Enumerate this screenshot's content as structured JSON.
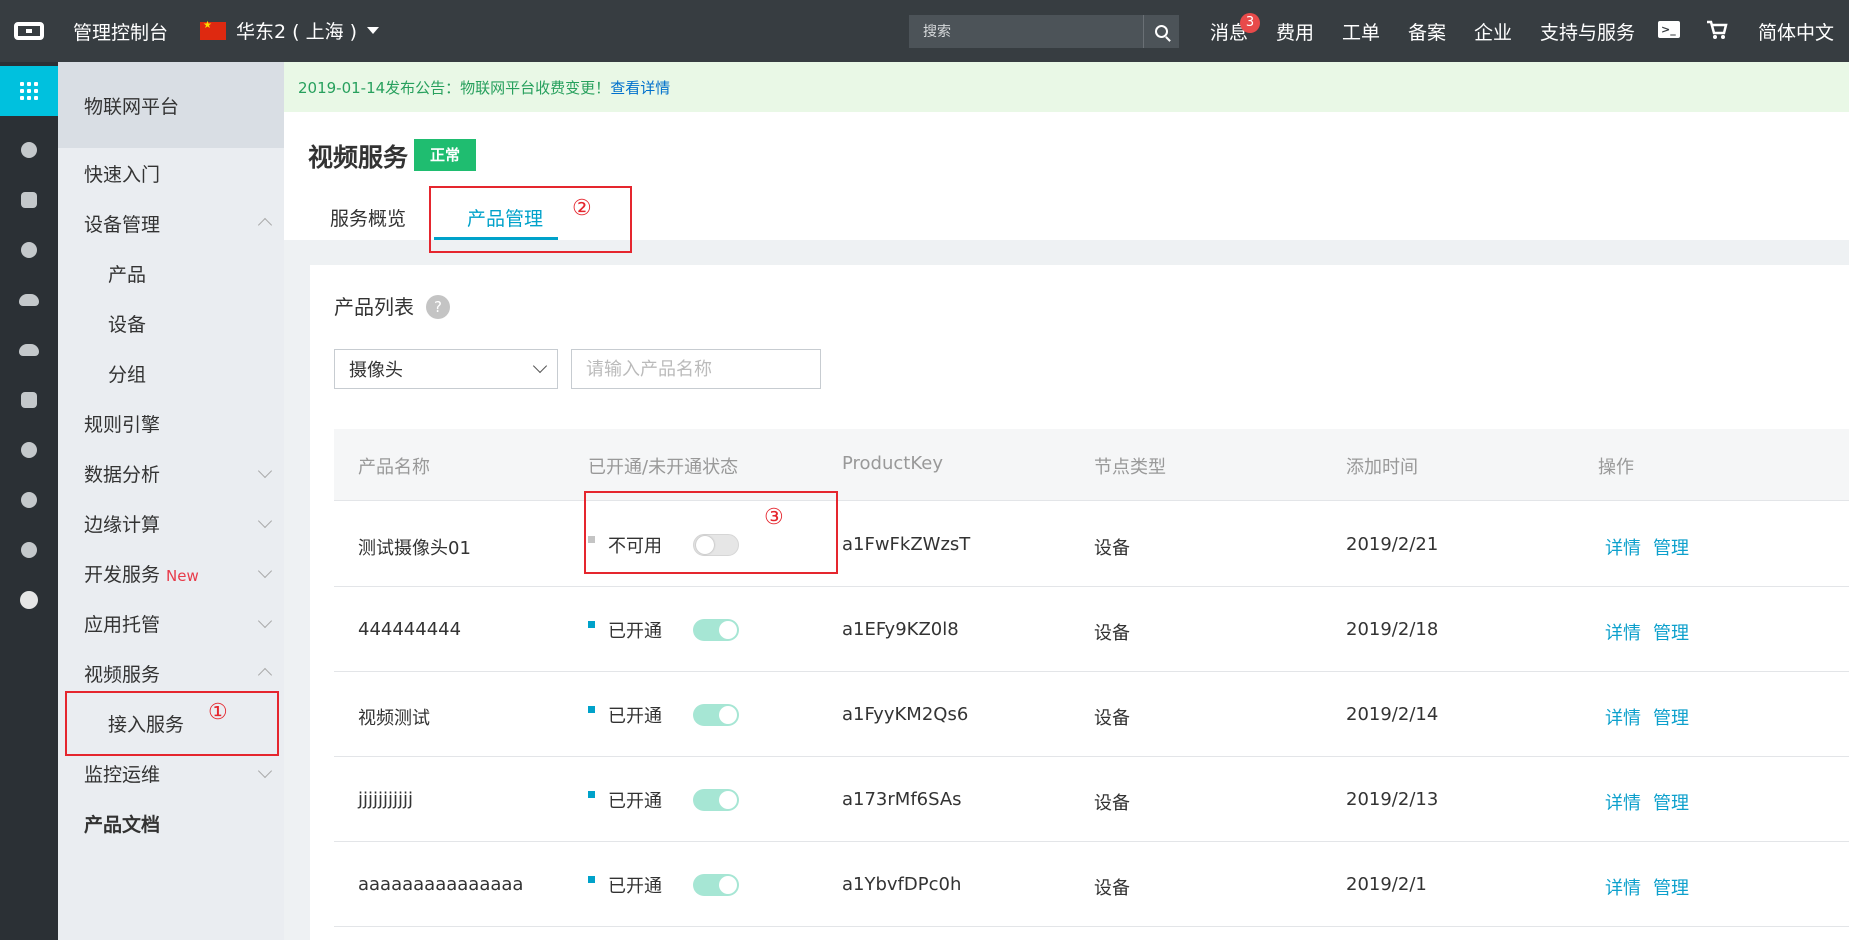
{
  "topbar": {
    "title": "管理控制台",
    "region": "华东2 ( 上海 )",
    "search_placeholder": "搜索",
    "nav": [
      "消息",
      "费用",
      "工单",
      "备案",
      "企业",
      "支持与服务"
    ],
    "message_count": "3",
    "language": "简体中文"
  },
  "rail_icons": [
    "apps-grid-icon",
    "search-circle-icon",
    "server-icon",
    "paw-icon",
    "cloud-icon",
    "cloud-upload-icon",
    "network-icon",
    "cluster-icon",
    "globe-icon",
    "iot-icon",
    "circle-icon"
  ],
  "sidemenu": {
    "header": "物联网平台",
    "items": {
      "quickstart": "快速入门",
      "device_mgmt": "设备管理",
      "product": "产品",
      "device": "设备",
      "group": "分组",
      "rules": "规则引擎",
      "analytics": "数据分析",
      "edge": "边缘计算",
      "dev_service": "开发服务",
      "new_tag": "New",
      "hosting": "应用托管",
      "video": "视频服务",
      "access": "接入服务",
      "monitor": "监控运维",
      "docs": "产品文档"
    }
  },
  "notice": {
    "text": "2019-01-14发布公告：物联网平台收费变更！",
    "link": "查看详情"
  },
  "page": {
    "title": "视频服务",
    "status": "正常",
    "tabs": [
      "服务概览",
      "产品管理"
    ]
  },
  "annotations": [
    "①",
    "②",
    "③"
  ],
  "panel": {
    "title": "产品列表",
    "help": "?",
    "select_value": "摄像头",
    "input_placeholder": "请输入产品名称"
  },
  "table": {
    "columns": [
      "产品名称",
      "已开通/未开通状态",
      "ProductKey",
      "节点类型",
      "添加时间",
      "操作"
    ],
    "rows": [
      {
        "name": "测试摄像头01",
        "status": "不可用",
        "enabled": false,
        "key": "a1FwFkZWzsT",
        "node": "设备",
        "date": "2019/2/21"
      },
      {
        "name": "444444444",
        "status": "已开通",
        "enabled": true,
        "key": "a1EFy9KZ0l8",
        "node": "设备",
        "date": "2019/2/18"
      },
      {
        "name": "视频测试",
        "status": "已开通",
        "enabled": true,
        "key": "a1FyyKM2Qs6",
        "node": "设备",
        "date": "2019/2/14"
      },
      {
        "name": "jjjjjjjjjjj",
        "status": "已开通",
        "enabled": true,
        "key": "a173rMf6SAs",
        "node": "设备",
        "date": "2019/2/13"
      },
      {
        "name": "aaaaaaaaaaaaaaa",
        "status": "已开通",
        "enabled": true,
        "key": "a1YbvfDPc0h",
        "node": "设备",
        "date": "2019/2/1"
      }
    ],
    "actions": [
      "详情",
      "管理"
    ]
  },
  "colors": {
    "accent": "#00a2ca",
    "topbar": "#373d41",
    "annotation_red": "#e5262e",
    "status_green": "#1fbd70"
  }
}
